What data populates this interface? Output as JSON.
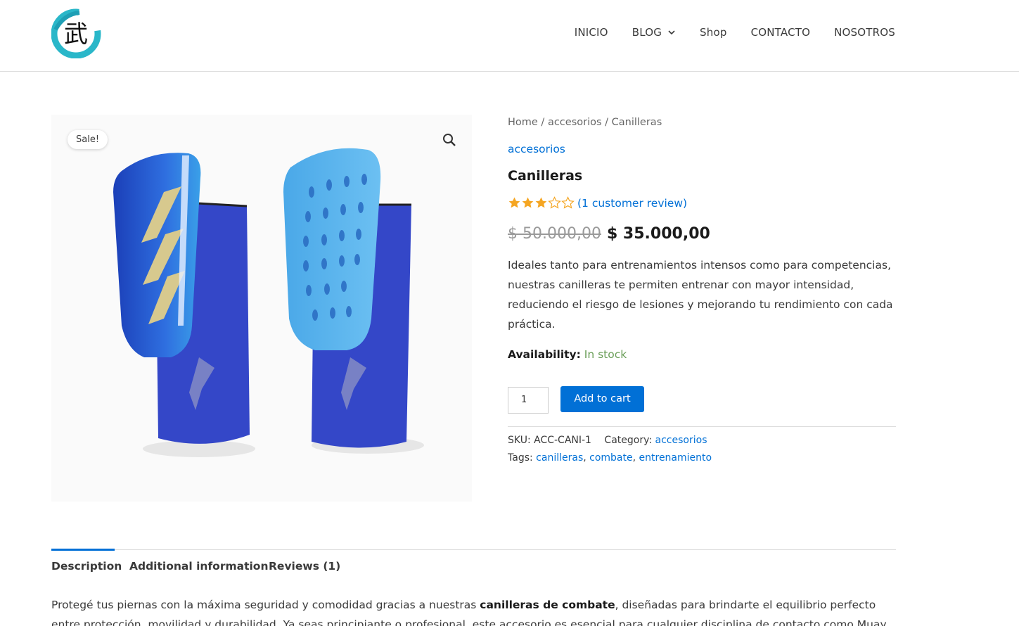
{
  "header": {
    "logo_glyph": "武",
    "nav": [
      {
        "label": "INICIO"
      },
      {
        "label": "BLOG",
        "has_dropdown": true
      },
      {
        "label": "Shop"
      },
      {
        "label": "CONTACTO"
      },
      {
        "label": "NOSOTROS"
      }
    ]
  },
  "gallery": {
    "sale_badge": "Sale!",
    "zoom_icon": "search-icon"
  },
  "product": {
    "breadcrumb": {
      "home": "Home",
      "sep1": " / ",
      "category": "accesorios",
      "sep2": " / ",
      "current": "Canilleras"
    },
    "category_link": "accesorios",
    "title": "Canilleras",
    "rating": 3,
    "rating_max": 5,
    "review_link": "(1 customer review)",
    "old_price": "$ 50.000,00",
    "new_price": "$ 35.000,00",
    "description": "Ideales tanto para entrenamientos intensos como para competencias, nuestras canilleras te permiten entrenar con mayor intensidad, reduciendo el riesgo de lesiones y mejorando tu rendimiento con cada práctica.",
    "availability_label": "Availability:",
    "availability_value": "In stock",
    "quantity": "1",
    "add_to_cart": "Add to cart",
    "sku_label": "SKU:",
    "sku_value": "ACC-CANI-1",
    "category_label": "Category:",
    "category_value": "accesorios",
    "tags_label": "Tags:",
    "tags": [
      "canilleras",
      "combate",
      "entrenamiento"
    ]
  },
  "tabs": {
    "items": [
      {
        "label": "Description"
      },
      {
        "label": "Additional information"
      },
      {
        "label": "Reviews (1)"
      }
    ],
    "description_pre": "Protegé tus piernas con la máxima seguridad y comodidad gracias a nuestras ",
    "description_bold": "canilleras de combate",
    "description_post": ", diseñadas para brindarte el equilibrio perfecto entre protección, movilidad y durabilidad. Ya seas principiante o profesional, este accesorio es esencial para cualquier disciplina de contacto como Muay Thai"
  },
  "colors": {
    "accent": "#0170d6",
    "star": "#f5a623",
    "in_stock": "#6a9e58"
  }
}
